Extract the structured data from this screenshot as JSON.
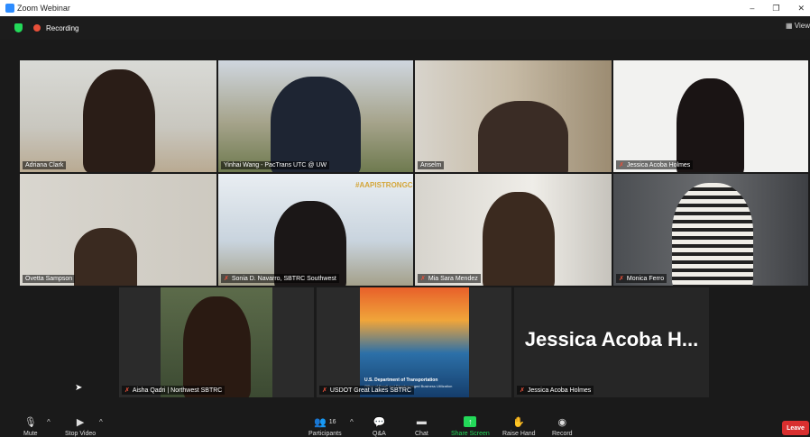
{
  "window": {
    "title": "Zoom Webinar",
    "minimize": "–",
    "restore": "❐",
    "close": "✕"
  },
  "topbar": {
    "recording_label": "Recording",
    "view_label": "View"
  },
  "participants_grid": [
    {
      "name": "Adriana Clark",
      "muted": false,
      "active_speaker": true
    },
    {
      "name": "Yinhai Wang - PacTrans UTC @ UW",
      "muted": false
    },
    {
      "name": "Anselm",
      "muted": false
    },
    {
      "name": "Jessica Acoba Holmes",
      "muted": true
    },
    {
      "name": "Ovetta Sampson",
      "muted": false
    },
    {
      "name": "Sonia D. Navarro, SBTRC Southwest",
      "muted": true
    },
    {
      "name": "Mia Sara Mendez",
      "muted": true
    },
    {
      "name": "Monica Ferro",
      "muted": true
    },
    {
      "name": "Aisha Qadri | Northwest SBTRC",
      "muted": true
    },
    {
      "name": "USDOT Great Lakes SBTRC",
      "muted": true
    },
    {
      "name": "Jessica Acoba Holmes",
      "muted": true,
      "display_name_large": "Jessica Acoba H..."
    }
  ],
  "tile_texts": {
    "sonia_banner": "#AAPISTRONGCA",
    "poster_line1": "U.S. Department of Transportation",
    "poster_line2": "Office of Small and Disadvantaged Business Utilization"
  },
  "toolbar": {
    "mute": "Mute",
    "stop_video": "Stop Video",
    "participants": "Participants",
    "participants_count": "16",
    "qa": "Q&A",
    "chat": "Chat",
    "share_screen": "Share Screen",
    "raise_hand": "Raise Hand",
    "record": "Record",
    "leave": "Leave"
  },
  "colors": {
    "accent_green": "#23d959",
    "active_speaker": "#b2e36a",
    "leave_red": "#d92f2f",
    "mic_muted": "#e8503a"
  }
}
